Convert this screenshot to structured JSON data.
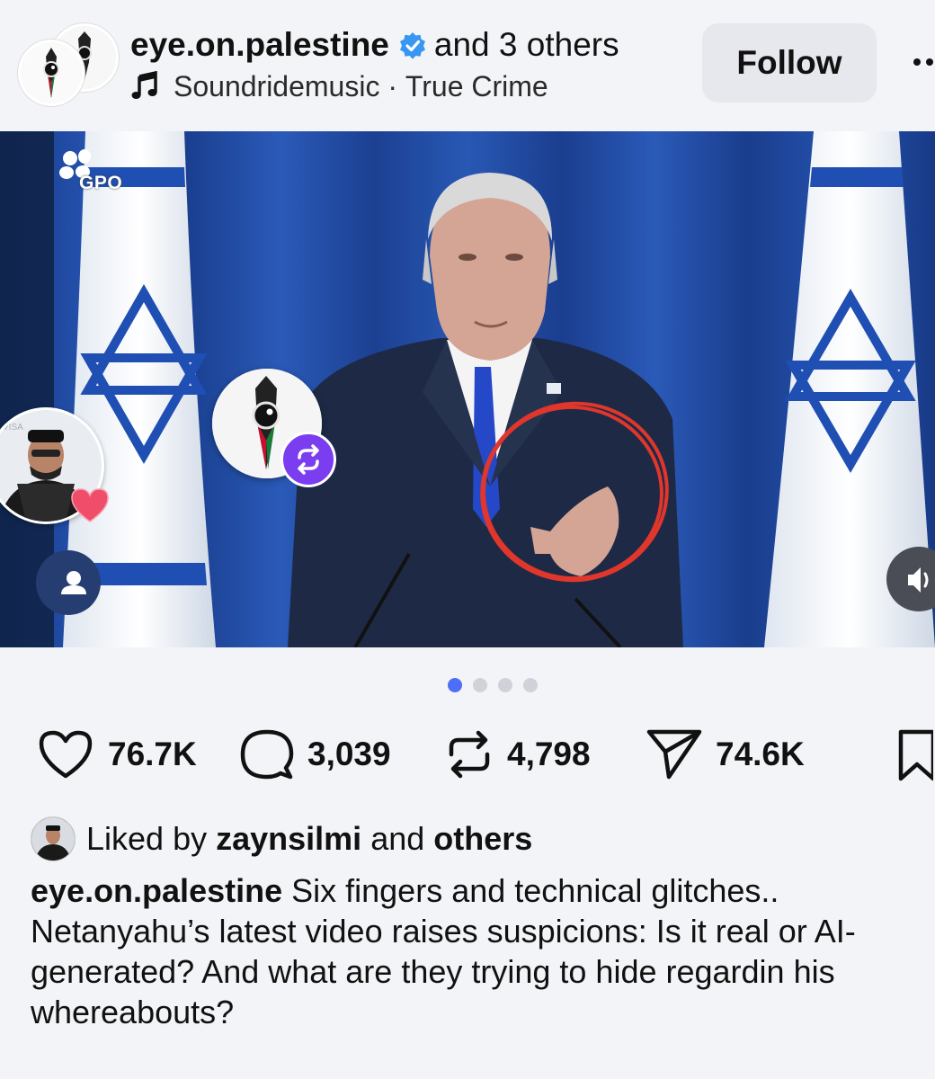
{
  "header": {
    "username": "eye.on.palestine",
    "collab_text": "and 3 others",
    "music_artist": "Soundridemusic",
    "separator": " · ",
    "music_title": "True Crime",
    "follow_label": "Follow"
  },
  "media": {
    "watermark": "GPO",
    "page_count": 4,
    "active_page": 1,
    "left_avatar_tag": "VISA"
  },
  "actions": {
    "likes": "76.7K",
    "comments": "3,039",
    "reposts": "4,798",
    "shares": "74.6K"
  },
  "liked_by": {
    "prefix": "Liked by",
    "user": "zaynsilmi",
    "conjunction": "and",
    "suffix": "others"
  },
  "caption": {
    "username": "eye.on.palestine",
    "text": "Six fingers and technical glitches.. Netanyahu’s latest video raises suspicions: Is it real or AI-generated? And what are they trying to hide regardin his whereabouts?"
  },
  "colors": {
    "verified": "#3897f0",
    "repost_badge": "#7b3df0",
    "active_dot": "#4f6ef7",
    "flag_blue": "#1f4fb3",
    "circle_red": "#e0362c"
  },
  "icons": [
    "verified-icon",
    "music-note-icon",
    "more-icon",
    "heart-icon",
    "comment-icon",
    "repost-icon",
    "share-icon",
    "save-icon",
    "user-icon",
    "volume-icon"
  ]
}
